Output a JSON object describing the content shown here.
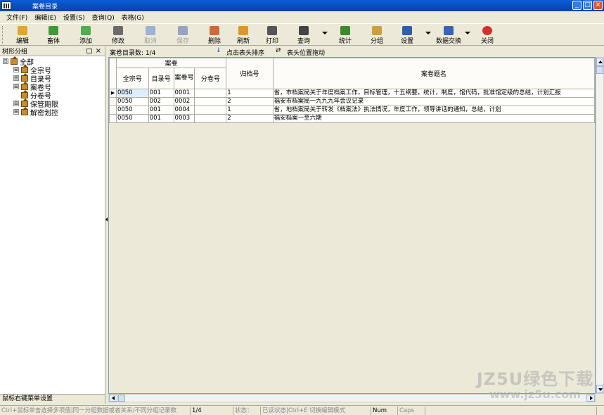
{
  "window": {
    "title": "案卷目录"
  },
  "menu": [
    "文件(F)",
    "编辑(E)",
    "设置(S)",
    "查询(Q)",
    "表格(G)"
  ],
  "toolbar": [
    {
      "label": "编辑",
      "icon": "edit-icon",
      "color": "#e2a72a",
      "disabled": false
    },
    {
      "label": "畜体",
      "icon": "table-icon",
      "color": "#3f9a3a",
      "disabled": false
    },
    {
      "label": "添加",
      "icon": "add-icon",
      "color": "#4caf50",
      "disabled": false
    },
    {
      "label": "修改",
      "icon": "modify-icon",
      "color": "#6b6b6b",
      "disabled": false
    },
    {
      "label": "取消",
      "icon": "cancel-icon",
      "color": "#3d6fd1",
      "disabled": true
    },
    {
      "label": "保存",
      "icon": "save-icon",
      "color": "#2e4fa8",
      "disabled": true
    },
    {
      "label": "删除",
      "icon": "delete-icon",
      "color": "#d2693c",
      "disabled": false
    },
    {
      "label": "刷新",
      "icon": "refresh-icon",
      "color": "#d99a1f",
      "disabled": false
    },
    {
      "label": "打印",
      "icon": "print-icon",
      "color": "#555555",
      "disabled": false
    },
    {
      "label": "查询",
      "icon": "search-icon",
      "color": "#444444",
      "disabled": false
    },
    {
      "label": "统计",
      "icon": "stats-icon",
      "color": "#3b8a2c",
      "disabled": false
    },
    {
      "label": "分组",
      "icon": "group-icon",
      "color": "#c9a23b",
      "disabled": false
    },
    {
      "label": "设置",
      "icon": "settings-icon",
      "color": "#2f5db0",
      "disabled": false
    },
    {
      "label": "数据交换",
      "icon": "exchange-icon",
      "color": "#3a62b8",
      "disabled": false
    },
    {
      "label": "关闭",
      "icon": "close-icon",
      "color": "#d62f2f",
      "disabled": false
    }
  ],
  "left_panel": {
    "title": "树形分组",
    "footer": "鼠标右键菜单设置",
    "tree": [
      {
        "label": "全部",
        "expander": "⊟",
        "level": 0
      },
      {
        "label": "全宗号",
        "expander": "⊞",
        "level": 1
      },
      {
        "label": "目录号",
        "expander": "⊞",
        "level": 1
      },
      {
        "label": "案卷号",
        "expander": "⊞",
        "level": 1
      },
      {
        "label": "分卷号",
        "expander": "",
        "level": 1
      },
      {
        "label": "保管期限",
        "expander": "⊞",
        "level": 1
      },
      {
        "label": "解密划控",
        "expander": "⊞",
        "level": 1
      }
    ]
  },
  "info": {
    "count": "案卷目录数: 1/4",
    "sort_hint": "点击表头排序",
    "drag_hint": "表头位置拖动"
  },
  "grid": {
    "group_header": "案卷",
    "columns": [
      "全宗号",
      "目录号",
      "案卷号",
      "分卷号",
      "归档号",
      "案卷题名"
    ],
    "rows": [
      [
        "0050",
        "001",
        "0001",
        "",
        "1",
        "省，市档案局关于年度档案工作，目标管理，十五纲要，统计，制度，馆代码，批准馆定级的总结，计划汇报"
      ],
      [
        "0050",
        "002",
        "0002",
        "",
        "2",
        "福安市档案局一九九九年会议记录"
      ],
      [
        "0050",
        "001",
        "0004",
        "",
        "1",
        "省，地档案局关于转发《档案法》执法情况，年度工作，领导讲话的通知，总结，计划"
      ],
      [
        "0050",
        "001",
        "0003",
        "",
        "2",
        "福安档案一至六期"
      ]
    ],
    "current_row": 0
  },
  "status": [
    "Ctrl+鼠标单击选择多项值|同一分组数据或者关系/不同分组记录数",
    "1/4",
    "状态：",
    "已读状态|Ctrl+E 切换编辑模式",
    "Num",
    "Caps"
  ],
  "watermark": {
    "main": "JZ5U绿色下载",
    "sub": "www.jz5u.com"
  }
}
